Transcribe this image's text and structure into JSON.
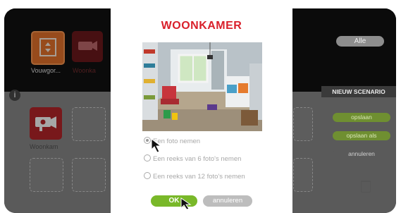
{
  "dashboard": {
    "top_tiles": [
      {
        "label": "Vouwgor..."
      },
      {
        "label": "Woonka"
      }
    ],
    "camera_tile_label": "Woonkam",
    "alle_button": "Alle"
  },
  "scenario_panel": {
    "title": "NIEUW SCENARIO",
    "save": "opslaan",
    "save_as": "opslaan als",
    "cancel": "annuleren"
  },
  "modal": {
    "title": "WOONKAMER",
    "options": [
      {
        "label": "Een foto nemen",
        "selected": true
      },
      {
        "label": "Een reeks van 6 foto's nemen",
        "selected": false
      },
      {
        "label": "Een reeks van 12 foto's nemen",
        "selected": false
      }
    ],
    "ok_label": "OK",
    "cancel_label": "annuleren"
  },
  "colors": {
    "accent_red": "#d9202b",
    "ok_green": "#79b829",
    "tile_orange": "#e8742b"
  }
}
